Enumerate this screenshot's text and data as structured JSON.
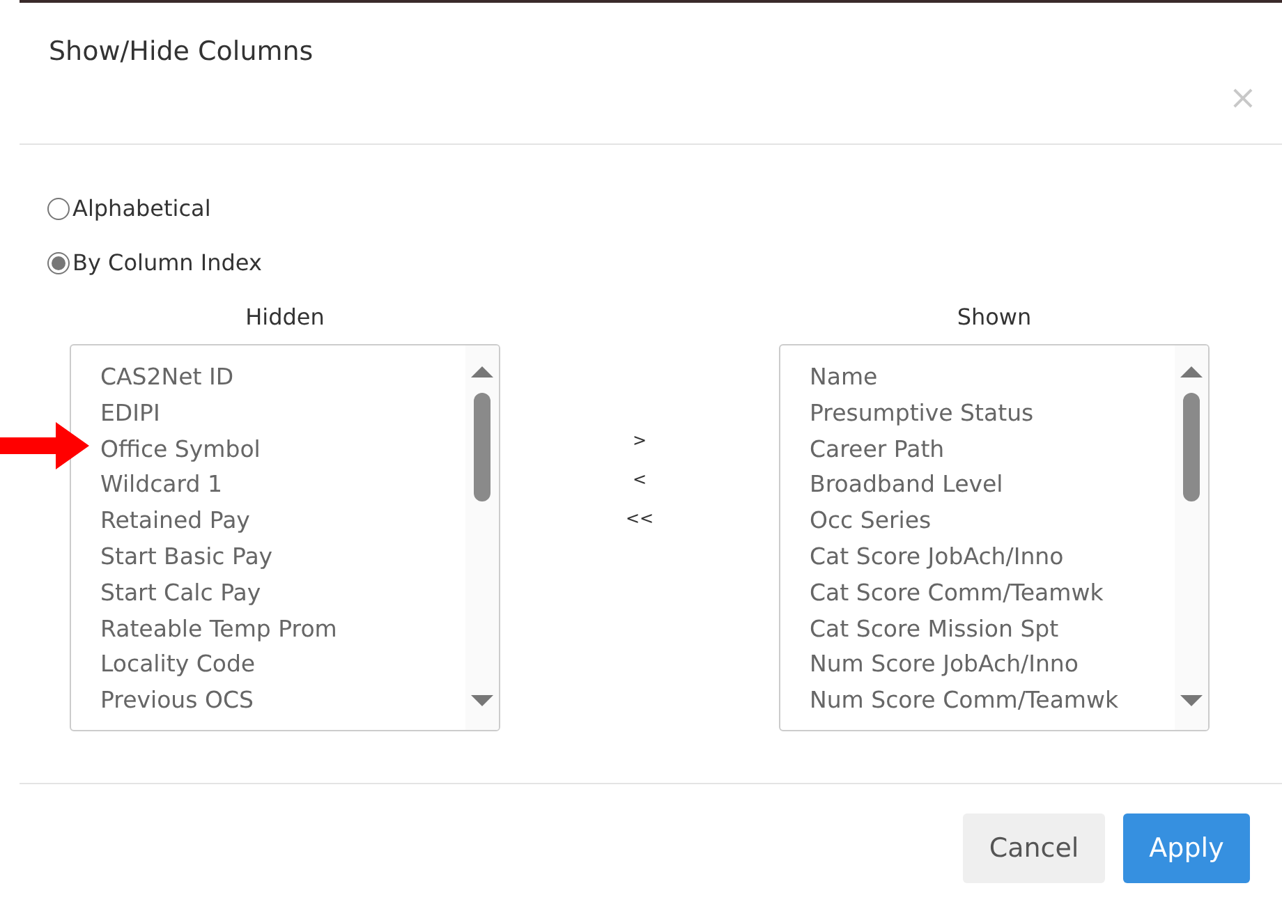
{
  "dialog": {
    "title": "Show/Hide Columns",
    "close": "×"
  },
  "sort_options": [
    {
      "label": "Alphabetical",
      "selected": false
    },
    {
      "label": "By Column Index",
      "selected": true
    }
  ],
  "hidden": {
    "heading": "Hidden",
    "items": [
      "CAS2Net ID",
      "EDIPI",
      "Office Symbol",
      "Wildcard 1",
      "Retained Pay",
      "Start Basic Pay",
      "Start Calc Pay",
      "Rateable Temp Prom",
      "Locality Code",
      "Previous OCS"
    ]
  },
  "move_buttons": [
    ">",
    "<",
    "<<"
  ],
  "shown": {
    "heading": "Shown",
    "items": [
      "Name",
      "Presumptive Status",
      "Career Path",
      "Broadband Level",
      "Occ Series",
      "Cat Score JobAch/Inno",
      "Cat Score Comm/Teamwk",
      "Cat Score Mission Spt",
      "Num Score JobAch/Inno",
      "Num Score Comm/Teamwk"
    ]
  },
  "buttons": [
    {
      "label": "Cancel",
      "kind": "secondary"
    },
    {
      "label": "Apply",
      "kind": "primary"
    }
  ]
}
